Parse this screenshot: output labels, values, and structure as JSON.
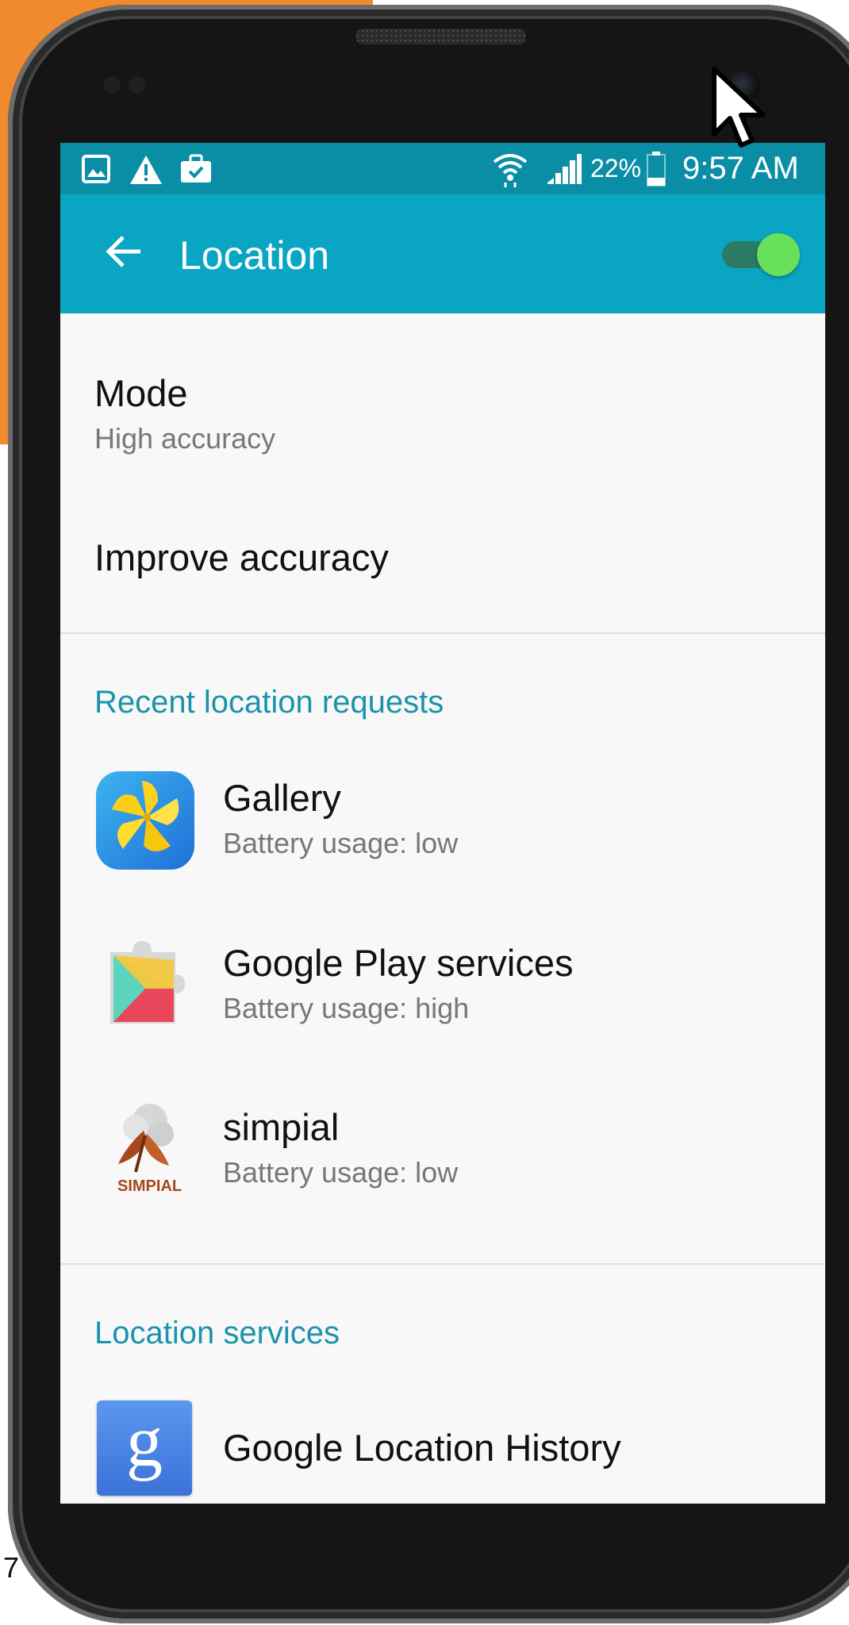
{
  "page_number": "7",
  "colors": {
    "status_bar": "#0a8ea6",
    "app_bar": "#0aa5c2",
    "section_header": "#1a93ab",
    "toggle_on": "#68e05a",
    "background_accent": "#f08a2c"
  },
  "status_bar": {
    "left_icons": [
      "gallery-icon",
      "warning-icon",
      "briefcase-check-icon"
    ],
    "wifi_icon": "wifi-icon",
    "signal_icon": "signal-icon",
    "battery_percent": "22%",
    "battery_icon": "battery-icon",
    "time": "9:57 AM"
  },
  "app_bar": {
    "back_icon": "arrow-left-icon",
    "title": "Location",
    "toggle_state": "on"
  },
  "settings": {
    "mode": {
      "title": "Mode",
      "subtitle": "High accuracy"
    },
    "improve_accuracy": {
      "title": "Improve accuracy"
    }
  },
  "recent_requests": {
    "header": "Recent location requests",
    "apps": [
      {
        "name": "Gallery",
        "battery": "Battery usage: low",
        "icon": "gallery-app-icon"
      },
      {
        "name": "Google Play services",
        "battery": "Battery usage: high",
        "icon": "google-play-services-icon"
      },
      {
        "name": "simpial",
        "battery": "Battery usage: low",
        "icon": "simpial-icon",
        "icon_caption": "SIMPIAL"
      }
    ]
  },
  "location_services": {
    "header": "Location services",
    "items": [
      {
        "name": "Google Location History",
        "icon": "google-g-icon",
        "icon_letter": "g"
      }
    ]
  }
}
